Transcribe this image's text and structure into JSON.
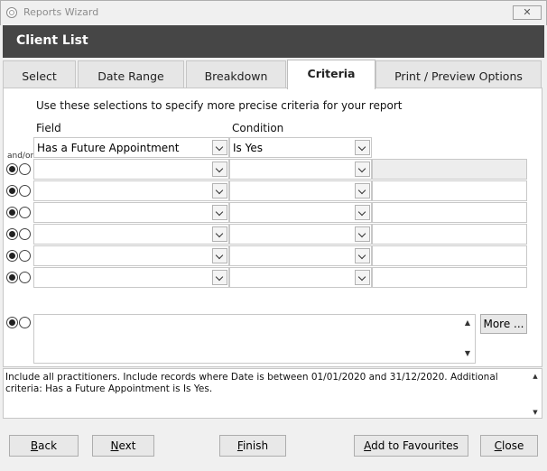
{
  "window": {
    "title": "Reports Wizard",
    "close_glyph": "✕"
  },
  "header": {
    "title": "Client List"
  },
  "tabs": [
    {
      "label": "Select",
      "active": false
    },
    {
      "label": "Date Range",
      "active": false
    },
    {
      "label": "Breakdown",
      "active": false
    },
    {
      "label": "Criteria",
      "active": true
    },
    {
      "label": "Print / Preview Options",
      "active": false
    }
  ],
  "criteria": {
    "instructions": "Use these selections to specify more precise criteria for your report",
    "field_header": "Field",
    "condition_header": "Condition",
    "andor_label": "and/or",
    "rows": [
      {
        "field": "Has a Future Appointment",
        "condition": "Is Yes"
      },
      {
        "field": "",
        "condition": ""
      },
      {
        "field": "",
        "condition": ""
      },
      {
        "field": "",
        "condition": ""
      },
      {
        "field": "",
        "condition": ""
      },
      {
        "field": "",
        "condition": ""
      },
      {
        "field": "",
        "condition": ""
      },
      {
        "field": "",
        "condition": ""
      }
    ],
    "andor_rows": [
      {
        "and": true
      },
      {
        "and": true
      },
      {
        "and": true
      },
      {
        "and": true
      },
      {
        "and": true
      },
      {
        "and": true
      },
      {
        "and": true
      },
      {
        "and": true
      }
    ],
    "more_button": "More ...",
    "free_text": ""
  },
  "summary": {
    "text": "Include all practitioners. Include records where Date is between 01/01/2020 and 31/12/2020. Additional criteria: Has a Future Appointment is Is Yes."
  },
  "buttons": {
    "back": "Back",
    "next": "Next",
    "finish": "Finish",
    "add_to_favourites": "Add to Favourites",
    "close": "Close"
  }
}
